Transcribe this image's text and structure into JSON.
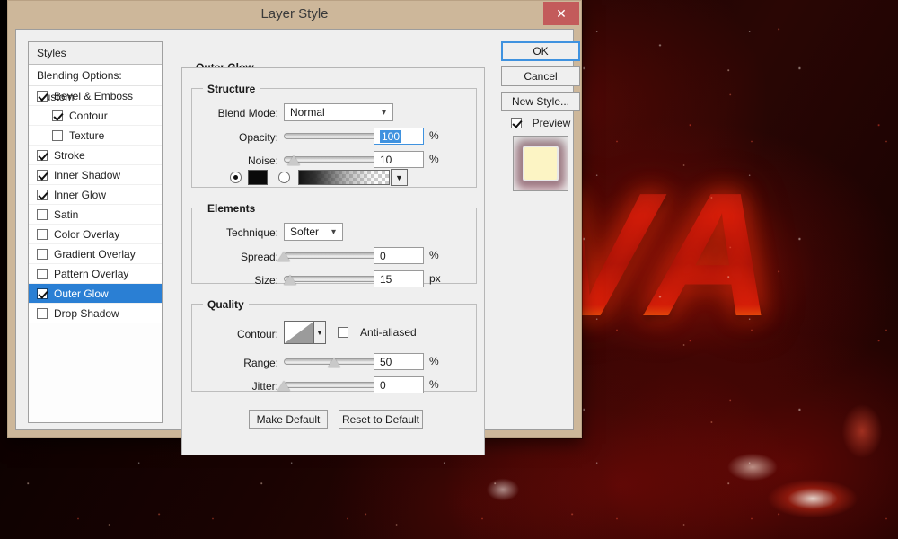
{
  "background": {
    "artwork_text": "VA",
    "description": "lava-text-artwork"
  },
  "dialog": {
    "title": "Layer Style",
    "close_label": "✕"
  },
  "styles_panel": {
    "header": "Styles",
    "blending_options": "Blending Options: Custom",
    "items": [
      {
        "label": "Bevel & Emboss",
        "checked": true,
        "indent": false,
        "selected": false
      },
      {
        "label": "Contour",
        "checked": true,
        "indent": true,
        "selected": false
      },
      {
        "label": "Texture",
        "checked": false,
        "indent": true,
        "selected": false
      },
      {
        "label": "Stroke",
        "checked": true,
        "indent": false,
        "selected": false
      },
      {
        "label": "Inner Shadow",
        "checked": true,
        "indent": false,
        "selected": false
      },
      {
        "label": "Inner Glow",
        "checked": true,
        "indent": false,
        "selected": false
      },
      {
        "label": "Satin",
        "checked": false,
        "indent": false,
        "selected": false
      },
      {
        "label": "Color Overlay",
        "checked": false,
        "indent": false,
        "selected": false
      },
      {
        "label": "Gradient Overlay",
        "checked": false,
        "indent": false,
        "selected": false
      },
      {
        "label": "Pattern Overlay",
        "checked": false,
        "indent": false,
        "selected": false
      },
      {
        "label": "Outer Glow",
        "checked": true,
        "indent": false,
        "selected": true
      },
      {
        "label": "Drop Shadow",
        "checked": false,
        "indent": false,
        "selected": false
      }
    ]
  },
  "settings": {
    "section_title": "Outer Glow",
    "structure": {
      "title": "Structure",
      "blend_mode_label": "Blend Mode:",
      "blend_mode_value": "Normal",
      "opacity_label": "Opacity:",
      "opacity_value": "100",
      "opacity_unit": "%",
      "opacity_pct": 100,
      "noise_label": "Noise:",
      "noise_value": "10",
      "noise_unit": "%",
      "noise_pct": 10,
      "fill_type": "gradient-row",
      "color_selected": true,
      "color_hex": "#0a0a0a"
    },
    "elements": {
      "title": "Elements",
      "technique_label": "Technique:",
      "technique_value": "Softer",
      "spread_label": "Spread:",
      "spread_value": "0",
      "spread_unit": "%",
      "spread_pct": 0,
      "size_label": "Size:",
      "size_value": "15",
      "size_unit": "px",
      "size_pct": 6
    },
    "quality": {
      "title": "Quality",
      "contour_label": "Contour:",
      "anti_aliased_label": "Anti-aliased",
      "anti_aliased_checked": false,
      "range_label": "Range:",
      "range_value": "50",
      "range_unit": "%",
      "range_pct": 50,
      "jitter_label": "Jitter:",
      "jitter_value": "0",
      "jitter_unit": "%",
      "jitter_pct": 0
    },
    "make_default_label": "Make Default",
    "reset_default_label": "Reset to Default"
  },
  "right_panel": {
    "ok_label": "OK",
    "cancel_label": "Cancel",
    "new_style_label": "New Style...",
    "preview_label": "Preview",
    "preview_checked": true
  },
  "colors": {
    "accent_blue": "#2a7fd4",
    "titlebar_tan": "#cdb79a",
    "close_red": "#c35b5b",
    "panel_gray": "#efefef"
  }
}
